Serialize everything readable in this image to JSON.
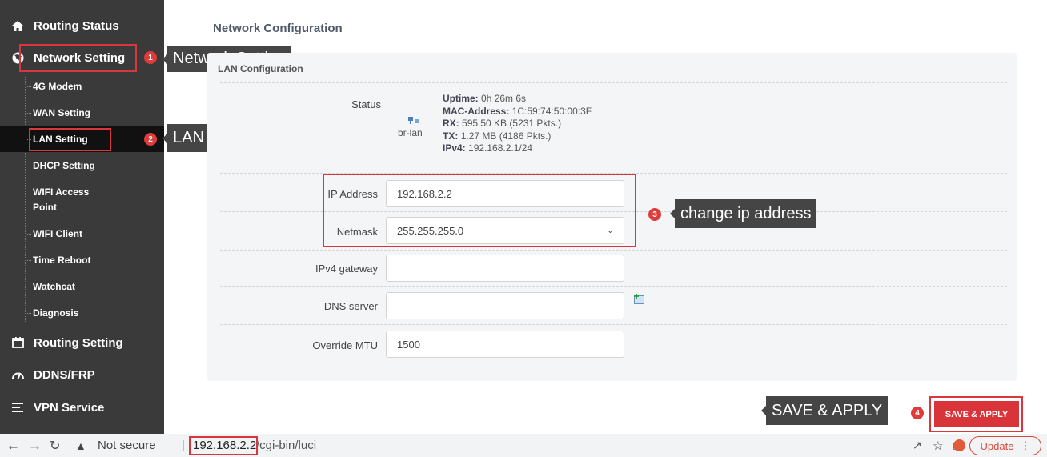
{
  "sidebar": {
    "items": [
      {
        "label": "Routing Status",
        "icon": "home-icon"
      },
      {
        "label": "Network Setting",
        "icon": "globe-icon"
      },
      {
        "label": "Routing Setting",
        "icon": "calendar-icon"
      },
      {
        "label": "DDNS/FRP",
        "icon": "speedometer-icon"
      },
      {
        "label": "VPN Service",
        "icon": "list-icon"
      }
    ],
    "subitems": [
      "4G Modem",
      "WAN Setting",
      "LAN Setting",
      "DHCP Setting",
      "WIFI Access",
      "Point",
      "WIFI Client",
      "Time Reboot",
      "Watchcat",
      "Diagnosis"
    ],
    "active_subitem": "LAN Setting"
  },
  "annotations": {
    "network_setting": {
      "number": "1",
      "text": "Network Setting"
    },
    "lan_setting": {
      "number": "2",
      "text": "LAN Setting"
    },
    "change_ip": {
      "number": "3",
      "text": "change ip address"
    },
    "save_apply": {
      "number": "4",
      "text": "SAVE & APPLY"
    }
  },
  "main": {
    "title": "Network Configuration",
    "section_title": "LAN Configuration",
    "status": {
      "label": "Status",
      "interface": "br-lan",
      "uptime_label": "Uptime:",
      "uptime": "0h 26m 6s",
      "mac_label": "MAC-Address:",
      "mac": "1C:59:74:50:00:3F",
      "rx_label": "RX:",
      "rx": "595.50 KB (5231 Pkts.)",
      "tx_label": "TX:",
      "tx": "1.27 MB (4186 Pkts.)",
      "ipv4_label": "IPv4:",
      "ipv4": "192.168.2.1/24"
    },
    "fields": {
      "ip_address": {
        "label": "IP Address",
        "value": "192.168.2.2"
      },
      "netmask": {
        "label": "Netmask",
        "value": "255.255.255.0"
      },
      "gateway": {
        "label": "IPv4 gateway",
        "value": ""
      },
      "dns": {
        "label": "DNS server",
        "value": ""
      },
      "mtu": {
        "label": "Override MTU",
        "value": "1500"
      }
    },
    "save_button": "SAVE & APPLY"
  },
  "browser": {
    "not_secure": "Not secure",
    "url_host": "192.168.2.2",
    "url_path": "/cgi-bin/luci",
    "update": "Update"
  },
  "colors": {
    "sidebar_bg": "#3a3a3a",
    "active_bg": "#111111",
    "accent_red": "#d9343a",
    "callout_bg": "#454545"
  }
}
